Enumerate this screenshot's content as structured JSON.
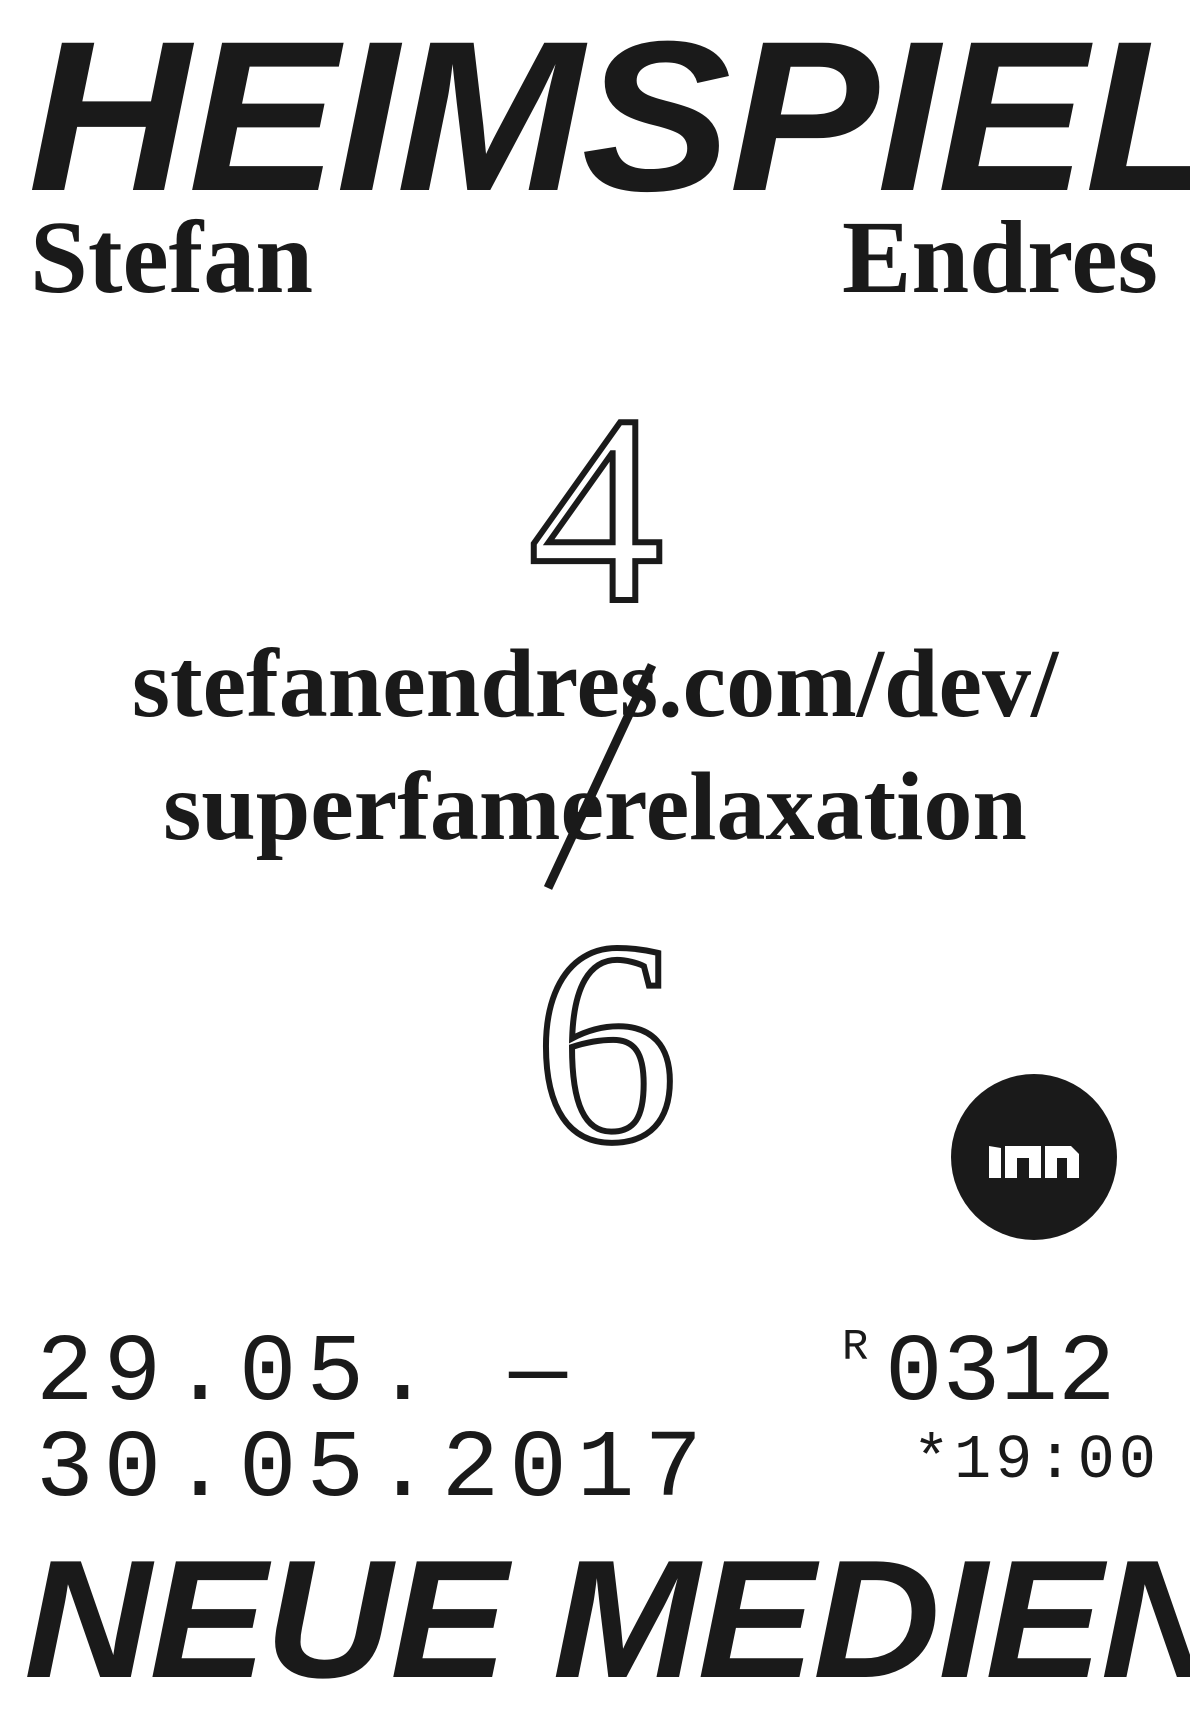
{
  "poster": {
    "title": "HEIMSPIEL",
    "artist_first_name": "Stefan",
    "artist_last_name": "Endres",
    "fraction_numerator": "4",
    "fraction_denominator": "6",
    "url_line_1": "stefanendres.com/dev/",
    "url_line_2": "superfamerelaxation",
    "date_start": "29.05. —",
    "date_end": "30.05.2017",
    "room_prefix": "R",
    "room_number": "0312",
    "time": "*19:00",
    "department": "NEUE MEDIEN",
    "logo": {
      "icon": "university-logo-icon",
      "color": "#1a1a1a"
    }
  }
}
